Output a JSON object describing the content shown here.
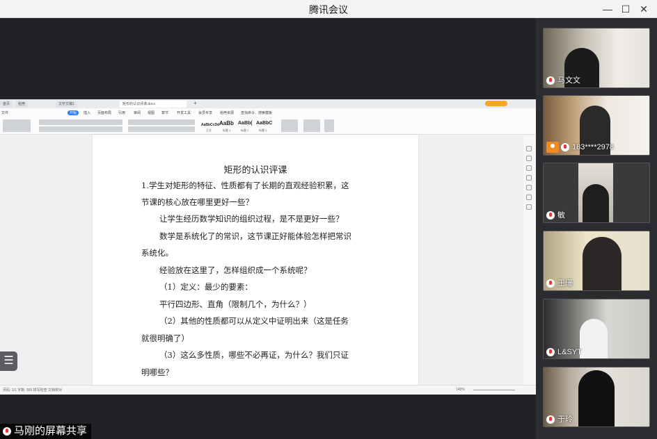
{
  "window": {
    "title": "腾讯会议"
  },
  "wps": {
    "tabs": [
      "首页",
      "稻壳",
      "文字文稿1",
      "矩形的认识评课.docx"
    ],
    "menu": [
      "文件",
      "开始",
      "插入",
      "页面布局",
      "引用",
      "审阅",
      "视图",
      "章节",
      "开发工具",
      "会员专享",
      "稻壳资源",
      "查找命令、搜索模板"
    ],
    "styles": [
      {
        "sample": "AaBbCcDd",
        "label": "正文"
      },
      {
        "sample": "AaBb",
        "label": "标题 1"
      },
      {
        "sample": "AaBb(",
        "label": "标题 2"
      },
      {
        "sample": "AaBbC",
        "label": "标题 3"
      }
    ],
    "status_left": "页码: 1/1   字数: 355   拼写检查   文档校对",
    "zoom": "145%"
  },
  "document": {
    "title": "矩形的认识评课",
    "lines": [
      "1.学生对矩形的特征、性质都有了长期的直观经验积累，这",
      "节课的核心放在哪里更好一些？",
      "让学生经历数学知识的组织过程，是不是更好一些？",
      "数学是系统化了的常识，这节课正好能体验怎样把常识",
      "系统化。",
      "经验放在这里了，怎样组织成一个系统呢？",
      "（1）定义：最少的要素：",
      "平行四边形、直角（限制几个，为什么？）",
      "（2）其他的性质都可以从定义中证明出来（这是任务",
      "就很明确了）",
      "（3）这么多性质，哪些不必再证，为什么？我们只证",
      "明哪些？"
    ]
  },
  "share_label": "马刚的屏幕共享",
  "list_icon": "☰",
  "participants": [
    {
      "name": "马文文",
      "bg": "#8a7d6b",
      "host_icon": false
    },
    {
      "name": "183****2978",
      "bg": "#b9a88d",
      "host_icon": true
    },
    {
      "name": "敏",
      "bg": "#3a3a3a",
      "host_icon": false
    },
    {
      "name": "王珊",
      "bg": "#d9c9a5",
      "host_icon": false
    },
    {
      "name": "L&SYT",
      "bg": "#8d8f8a",
      "host_icon": false
    },
    {
      "name": "于玲",
      "bg": "#9fa3a2",
      "host_icon": false
    }
  ]
}
